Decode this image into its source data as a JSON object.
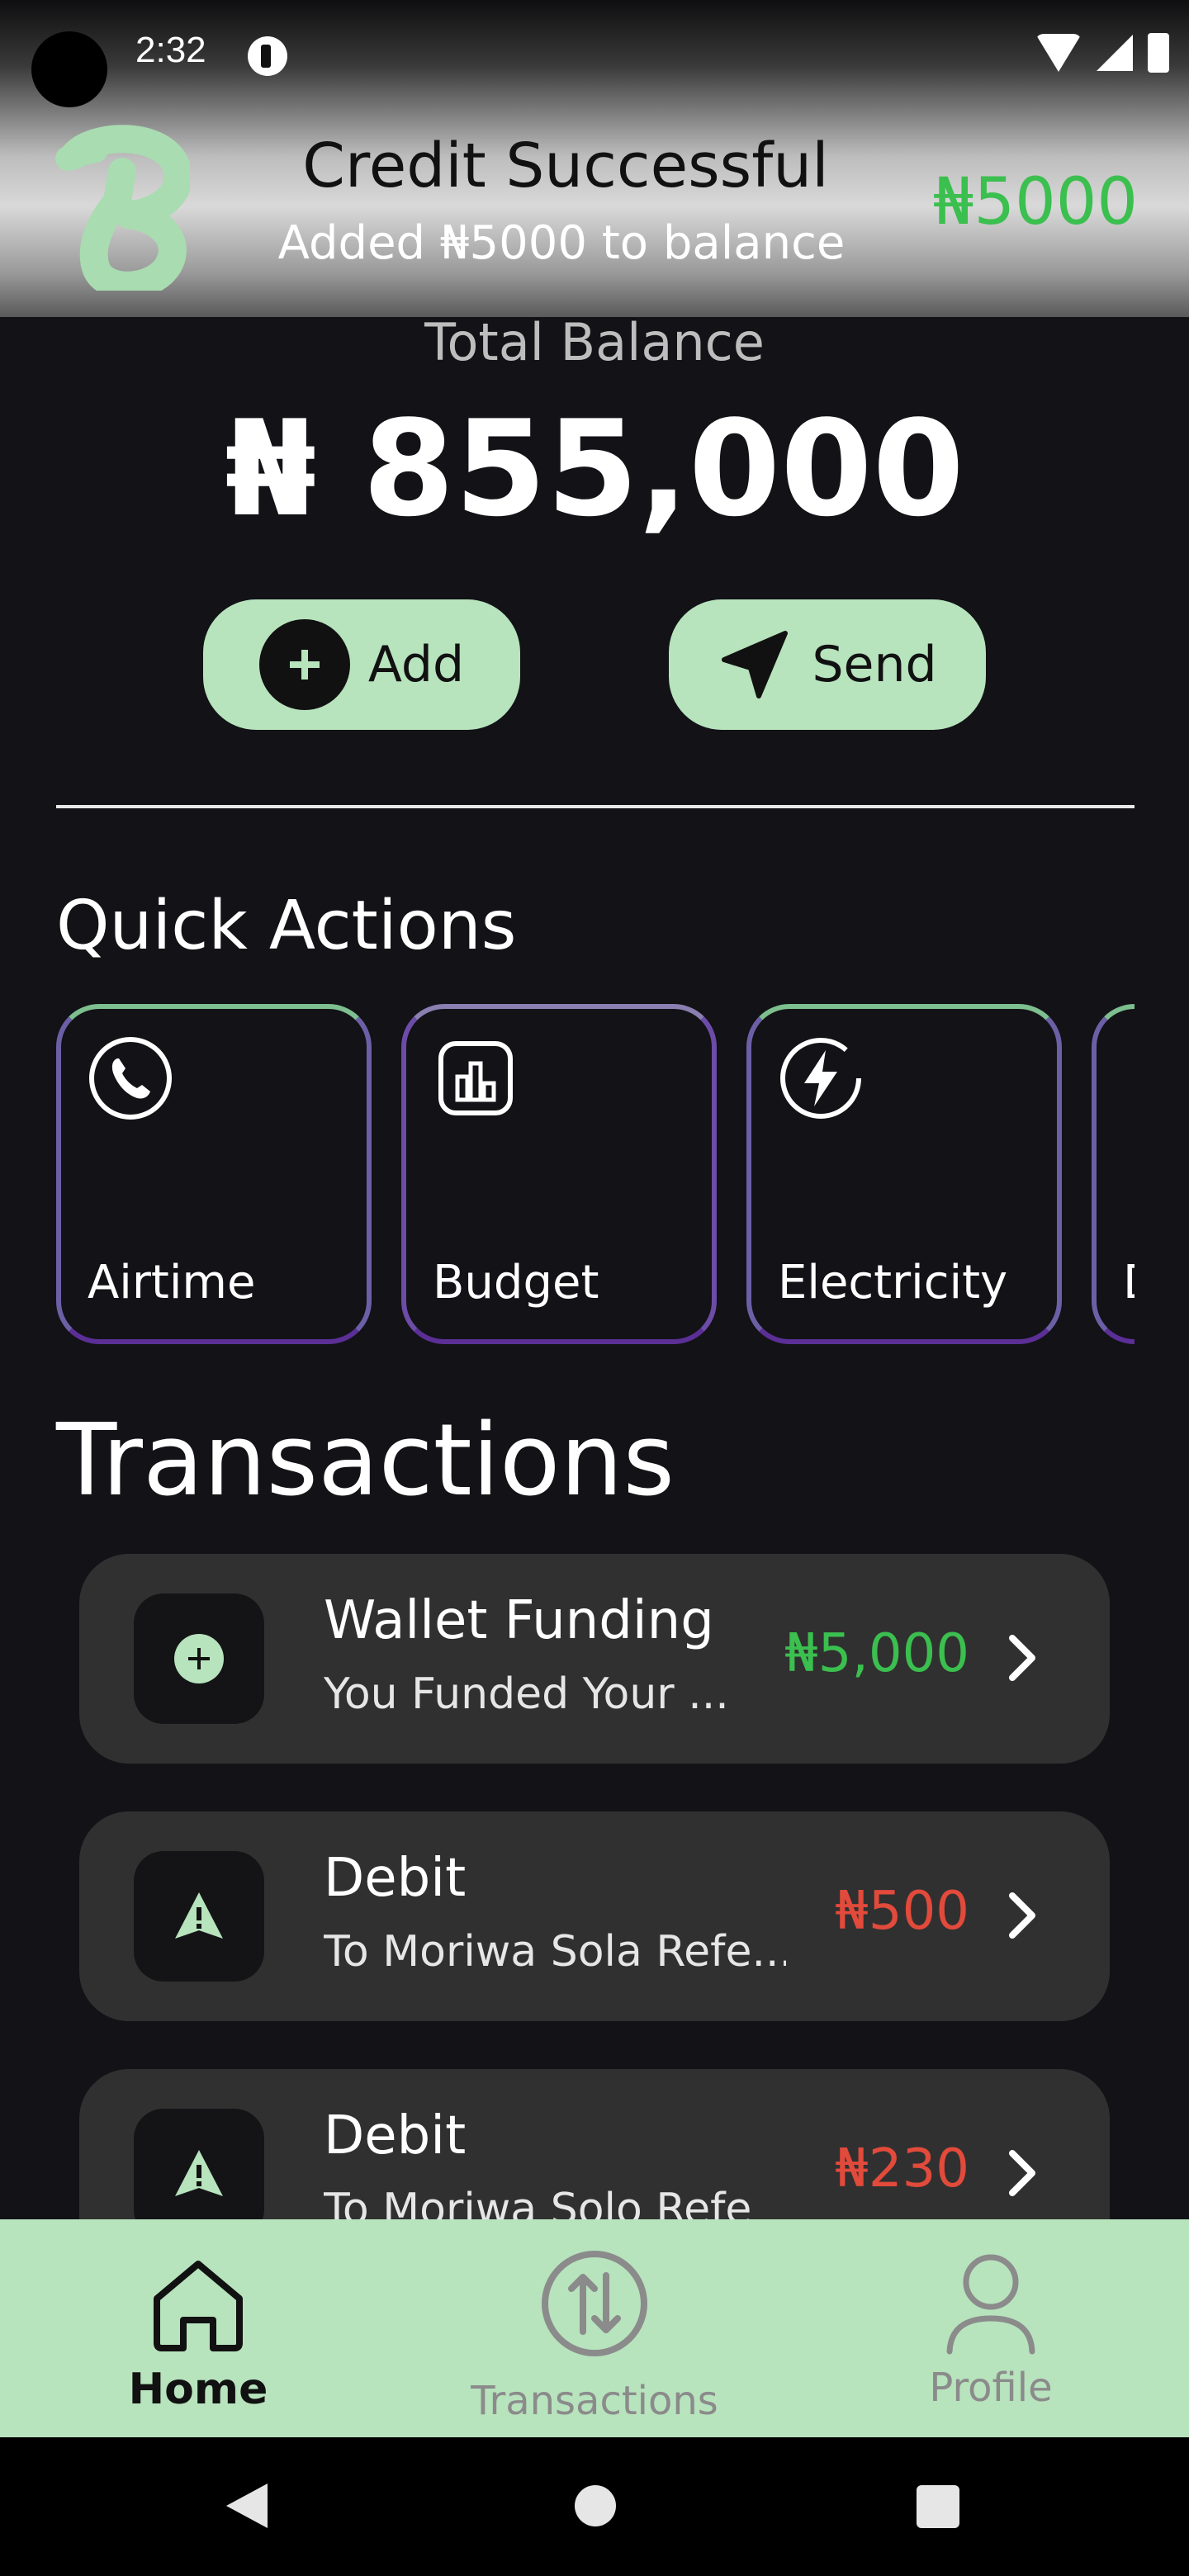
{
  "status_bar": {
    "time": "2:32"
  },
  "toast": {
    "title": "Credit Successful",
    "subtitle": "Added ₦5000 to balance",
    "amount": "₦5000",
    "logo_icon": "brand-logo-icon"
  },
  "balance": {
    "label": "Total Balance",
    "value": "₦ 855,000"
  },
  "actions": {
    "add_label": "Add",
    "send_label": "Send"
  },
  "quick_actions": {
    "title": "Quick Actions",
    "items": [
      {
        "label": "Airtime",
        "icon": "phone-icon"
      },
      {
        "label": "Budget",
        "icon": "chart-icon"
      },
      {
        "label": "Electricity",
        "icon": "lightning-icon"
      },
      {
        "label": "D",
        "icon": "partial-icon"
      }
    ]
  },
  "transactions": {
    "title": "Transactions",
    "items": [
      {
        "name": "Wallet Funding",
        "desc": "You Funded Your ...",
        "amount": "₦5,000",
        "type": "credit",
        "icon": "plus-icon"
      },
      {
        "name": "Debit",
        "desc": "To Moriwa Sola Refe...",
        "amount": "₦500",
        "type": "debit",
        "icon": "alert-triangle-icon"
      },
      {
        "name": "Debit",
        "desc": "To Moriwa Solo Refe",
        "amount": "₦230",
        "type": "debit",
        "icon": "alert-triangle-icon"
      }
    ]
  },
  "nav": {
    "home": "Home",
    "transactions": "Transactions",
    "profile": "Profile"
  },
  "colors": {
    "accent": "#b7e3bd",
    "credit": "#3bbf4f",
    "debit": "#e24a3b",
    "background": "#121217",
    "card": "#303030"
  }
}
